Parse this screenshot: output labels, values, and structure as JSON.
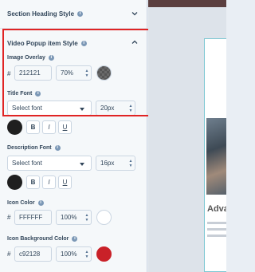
{
  "sections": {
    "section_heading": {
      "label": "Section Heading Style"
    },
    "video_popup": {
      "label": "Video Popup item Style"
    }
  },
  "image_overlay": {
    "label": "Image Overlay",
    "hex": "212121",
    "opacity": "70%",
    "swatch_color": "#212121"
  },
  "title_font": {
    "label": "Title Font",
    "select_value": "Select font",
    "size": "20px",
    "color": "#1f1f1f",
    "bold": "B",
    "italic": "I",
    "underline": "U"
  },
  "description_font": {
    "label": "Description Font",
    "select_value": "Select font",
    "size": "16px",
    "color": "#1f1f1f",
    "bold": "B",
    "italic": "I",
    "underline": "U"
  },
  "icon_color": {
    "label": "Icon Color",
    "hex": "FFFFFF",
    "opacity": "100%",
    "swatch_color": "#FFFFFF"
  },
  "icon_background_color": {
    "label": "Icon Background Color",
    "hex": "c92128",
    "opacity": "100%",
    "swatch_color": "#c92128"
  },
  "preview": {
    "title": "Adva"
  },
  "hash_symbol": "#",
  "info_glyph": "i",
  "accent_colors": {
    "highlight": "#e02424",
    "link": "#7c98b6"
  }
}
